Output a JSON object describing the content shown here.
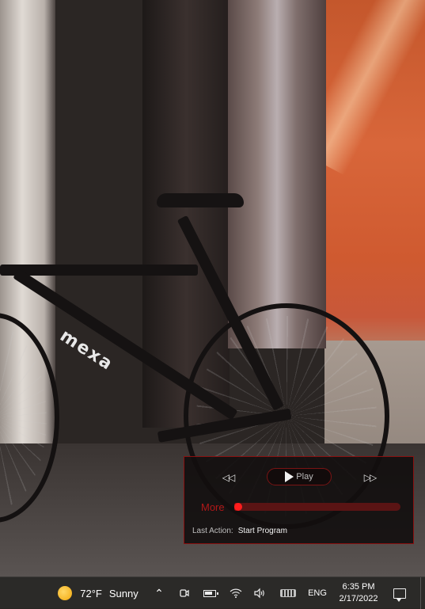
{
  "player": {
    "prev_icon": "rewind-icon",
    "play_label": "Play",
    "next_icon": "fast-forward-icon",
    "more_label": "More",
    "progress": 0,
    "last_action_label": "Last Action:",
    "last_action_value": "Start Program",
    "accent_color": "#b01818"
  },
  "taskbar": {
    "weather_temp": "72°F",
    "weather_condition": "Sunny",
    "weather_icon": "sun-icon",
    "tray_icons": [
      "chevron-up-icon",
      "meet-now-icon",
      "battery-icon",
      "wifi-icon",
      "volume-icon",
      "touch-keyboard-icon"
    ],
    "language": "ENG",
    "time": "6:35 PM",
    "date": "2/17/2022",
    "notification_icon": "notification-icon"
  }
}
